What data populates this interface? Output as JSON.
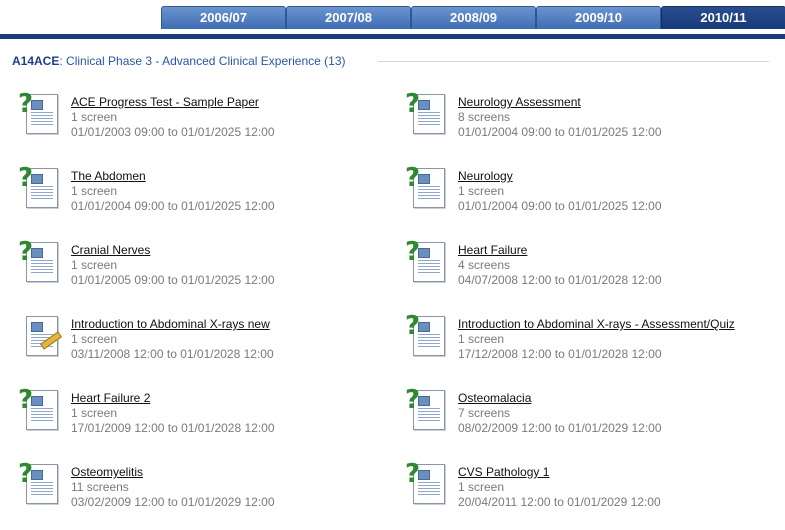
{
  "tabs": [
    {
      "label": "2006/07",
      "active": false
    },
    {
      "label": "2007/08",
      "active": false
    },
    {
      "label": "2008/09",
      "active": false
    },
    {
      "label": "2009/10",
      "active": false
    },
    {
      "label": "2010/11",
      "active": true
    }
  ],
  "section": {
    "code": "A14ACE",
    "title": ": Clinical Phase 3 - Advanced Clinical Experience (13)"
  },
  "items": [
    {
      "name": "ACE Progress Test - Sample Paper",
      "screens": "1 screen",
      "dates": "01/01/2003 09:00 to 01/01/2025 12:00",
      "icon": "quiz-icon"
    },
    {
      "name": "Neurology Assessment",
      "screens": "8 screens",
      "dates": "01/01/2004 09:00 to 01/01/2025 12:00",
      "icon": "quiz-icon"
    },
    {
      "name": "The Abdomen",
      "screens": "1 screen",
      "dates": "01/01/2004 09:00 to 01/01/2025 12:00",
      "icon": "quiz-icon"
    },
    {
      "name": "Neurology",
      "screens": "1 screen",
      "dates": "01/01/2004 09:00 to 01/01/2025 12:00",
      "icon": "quiz-icon"
    },
    {
      "name": "Cranial Nerves",
      "screens": "1 screen",
      "dates": "01/01/2005 09:00 to 01/01/2025 12:00",
      "icon": "quiz-icon"
    },
    {
      "name": "Heart Failure",
      "screens": "4 screens",
      "dates": "04/07/2008 12:00 to 01/01/2028 12:00",
      "icon": "quiz-icon"
    },
    {
      "name": "Introduction to Abdominal X-rays new",
      "screens": "1 screen",
      "dates": "03/11/2008 12:00 to 01/01/2028 12:00",
      "icon": "edit-document-icon"
    },
    {
      "name": "Introduction to Abdominal X-rays - Assessment/Quiz",
      "screens": "1 screen",
      "dates": "17/12/2008 12:00 to 01/01/2028 12:00",
      "icon": "quiz-icon"
    },
    {
      "name": "Heart Failure 2",
      "screens": "1 screen",
      "dates": "17/01/2009 12:00 to 01/01/2028 12:00",
      "icon": "quiz-icon"
    },
    {
      "name": "Osteomalacia",
      "screens": "7 screens",
      "dates": "08/02/2009 12:00 to 01/01/2029 12:00",
      "icon": "quiz-icon"
    },
    {
      "name": "Osteomyelitis",
      "screens": "11 screens",
      "dates": "03/02/2009 12:00 to 01/01/2029 12:00",
      "icon": "quiz-icon"
    },
    {
      "name": "CVS Pathology 1",
      "screens": "1 screen",
      "dates": "20/04/2011 12:00 to 01/01/2029 12:00",
      "icon": "quiz-icon"
    }
  ]
}
